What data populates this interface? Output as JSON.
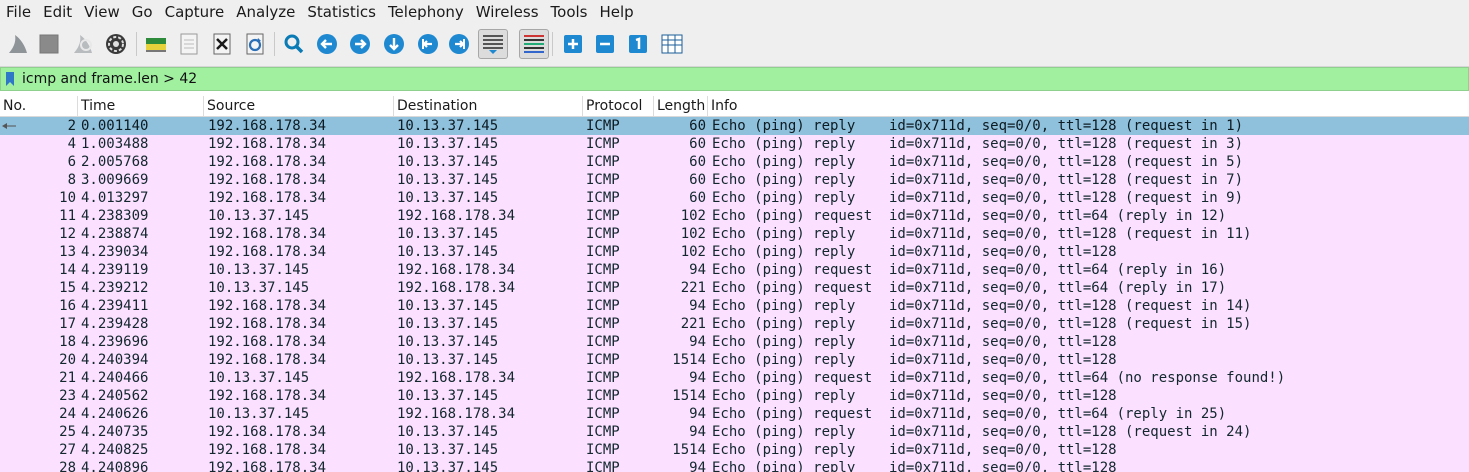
{
  "menu": [
    "File",
    "Edit",
    "View",
    "Go",
    "Capture",
    "Analyze",
    "Statistics",
    "Telephony",
    "Wireless",
    "Tools",
    "Help"
  ],
  "toolbar": {
    "icons": [
      "shark-fin-start-icon",
      "stop-square-icon",
      "shark-fin-restart-icon",
      "gear-options-icon",
      "open-file-icon",
      "file-icon",
      "close-file-icon",
      "reload-icon",
      "search-magnifier-icon",
      "go-back-icon",
      "go-forward-icon",
      "go-to-packet-icon",
      "go-first-icon",
      "go-last-icon",
      "autoscroll-icon",
      "colorize-icon",
      "zoom-in-icon",
      "zoom-out-icon",
      "normal-size-icon",
      "resize-columns-icon"
    ]
  },
  "filter": {
    "value": "icmp and frame.len > 42",
    "color": "#a0f0a0"
  },
  "columns": {
    "no": "No.",
    "time": "Time",
    "source": "Source",
    "destination": "Destination",
    "protocol": "Protocol",
    "length": "Length",
    "info": "Info"
  },
  "colors": {
    "row_bg": "#fce0ff",
    "selected_bg": "#8fc0dc"
  },
  "packets": [
    {
      "no": "2",
      "time": "0.001140",
      "source": "192.168.178.34",
      "destination": "10.13.37.145",
      "protocol": "ICMP",
      "length": "60",
      "info": "Echo (ping) reply    id=0x711d, seq=0/0, ttl=128 (request in 1)",
      "selected": true
    },
    {
      "no": "4",
      "time": "1.003488",
      "source": "192.168.178.34",
      "destination": "10.13.37.145",
      "protocol": "ICMP",
      "length": "60",
      "info": "Echo (ping) reply    id=0x711d, seq=0/0, ttl=128 (request in 3)"
    },
    {
      "no": "6",
      "time": "2.005768",
      "source": "192.168.178.34",
      "destination": "10.13.37.145",
      "protocol": "ICMP",
      "length": "60",
      "info": "Echo (ping) reply    id=0x711d, seq=0/0, ttl=128 (request in 5)"
    },
    {
      "no": "8",
      "time": "3.009669",
      "source": "192.168.178.34",
      "destination": "10.13.37.145",
      "protocol": "ICMP",
      "length": "60",
      "info": "Echo (ping) reply    id=0x711d, seq=0/0, ttl=128 (request in 7)"
    },
    {
      "no": "10",
      "time": "4.013297",
      "source": "192.168.178.34",
      "destination": "10.13.37.145",
      "protocol": "ICMP",
      "length": "60",
      "info": "Echo (ping) reply    id=0x711d, seq=0/0, ttl=128 (request in 9)"
    },
    {
      "no": "11",
      "time": "4.238309",
      "source": "10.13.37.145",
      "destination": "192.168.178.34",
      "protocol": "ICMP",
      "length": "102",
      "info": "Echo (ping) request  id=0x711d, seq=0/0, ttl=64 (reply in 12)"
    },
    {
      "no": "12",
      "time": "4.238874",
      "source": "192.168.178.34",
      "destination": "10.13.37.145",
      "protocol": "ICMP",
      "length": "102",
      "info": "Echo (ping) reply    id=0x711d, seq=0/0, ttl=128 (request in 11)"
    },
    {
      "no": "13",
      "time": "4.239034",
      "source": "192.168.178.34",
      "destination": "10.13.37.145",
      "protocol": "ICMP",
      "length": "102",
      "info": "Echo (ping) reply    id=0x711d, seq=0/0, ttl=128"
    },
    {
      "no": "14",
      "time": "4.239119",
      "source": "10.13.37.145",
      "destination": "192.168.178.34",
      "protocol": "ICMP",
      "length": "94",
      "info": "Echo (ping) request  id=0x711d, seq=0/0, ttl=64 (reply in 16)"
    },
    {
      "no": "15",
      "time": "4.239212",
      "source": "10.13.37.145",
      "destination": "192.168.178.34",
      "protocol": "ICMP",
      "length": "221",
      "info": "Echo (ping) request  id=0x711d, seq=0/0, ttl=64 (reply in 17)"
    },
    {
      "no": "16",
      "time": "4.239411",
      "source": "192.168.178.34",
      "destination": "10.13.37.145",
      "protocol": "ICMP",
      "length": "94",
      "info": "Echo (ping) reply    id=0x711d, seq=0/0, ttl=128 (request in 14)"
    },
    {
      "no": "17",
      "time": "4.239428",
      "source": "192.168.178.34",
      "destination": "10.13.37.145",
      "protocol": "ICMP",
      "length": "221",
      "info": "Echo (ping) reply    id=0x711d, seq=0/0, ttl=128 (request in 15)"
    },
    {
      "no": "18",
      "time": "4.239696",
      "source": "192.168.178.34",
      "destination": "10.13.37.145",
      "protocol": "ICMP",
      "length": "94",
      "info": "Echo (ping) reply    id=0x711d, seq=0/0, ttl=128"
    },
    {
      "no": "20",
      "time": "4.240394",
      "source": "192.168.178.34",
      "destination": "10.13.37.145",
      "protocol": "ICMP",
      "length": "1514",
      "info": "Echo (ping) reply    id=0x711d, seq=0/0, ttl=128"
    },
    {
      "no": "21",
      "time": "4.240466",
      "source": "10.13.37.145",
      "destination": "192.168.178.34",
      "protocol": "ICMP",
      "length": "94",
      "info": "Echo (ping) request  id=0x711d, seq=0/0, ttl=64 (no response found!)"
    },
    {
      "no": "23",
      "time": "4.240562",
      "source": "192.168.178.34",
      "destination": "10.13.37.145",
      "protocol": "ICMP",
      "length": "1514",
      "info": "Echo (ping) reply    id=0x711d, seq=0/0, ttl=128"
    },
    {
      "no": "24",
      "time": "4.240626",
      "source": "10.13.37.145",
      "destination": "192.168.178.34",
      "protocol": "ICMP",
      "length": "94",
      "info": "Echo (ping) request  id=0x711d, seq=0/0, ttl=64 (reply in 25)"
    },
    {
      "no": "25",
      "time": "4.240735",
      "source": "192.168.178.34",
      "destination": "10.13.37.145",
      "protocol": "ICMP",
      "length": "94",
      "info": "Echo (ping) reply    id=0x711d, seq=0/0, ttl=128 (request in 24)"
    },
    {
      "no": "27",
      "time": "4.240825",
      "source": "192.168.178.34",
      "destination": "10.13.37.145",
      "protocol": "ICMP",
      "length": "1514",
      "info": "Echo (ping) reply    id=0x711d, seq=0/0, ttl=128"
    },
    {
      "no": "28",
      "time": "4.240896",
      "source": "192.168.178.34",
      "destination": "10.13.37.145",
      "protocol": "ICMP",
      "length": "94",
      "info": "Echo (ping) reply    id=0x711d, seq=0/0, ttl=128"
    }
  ]
}
